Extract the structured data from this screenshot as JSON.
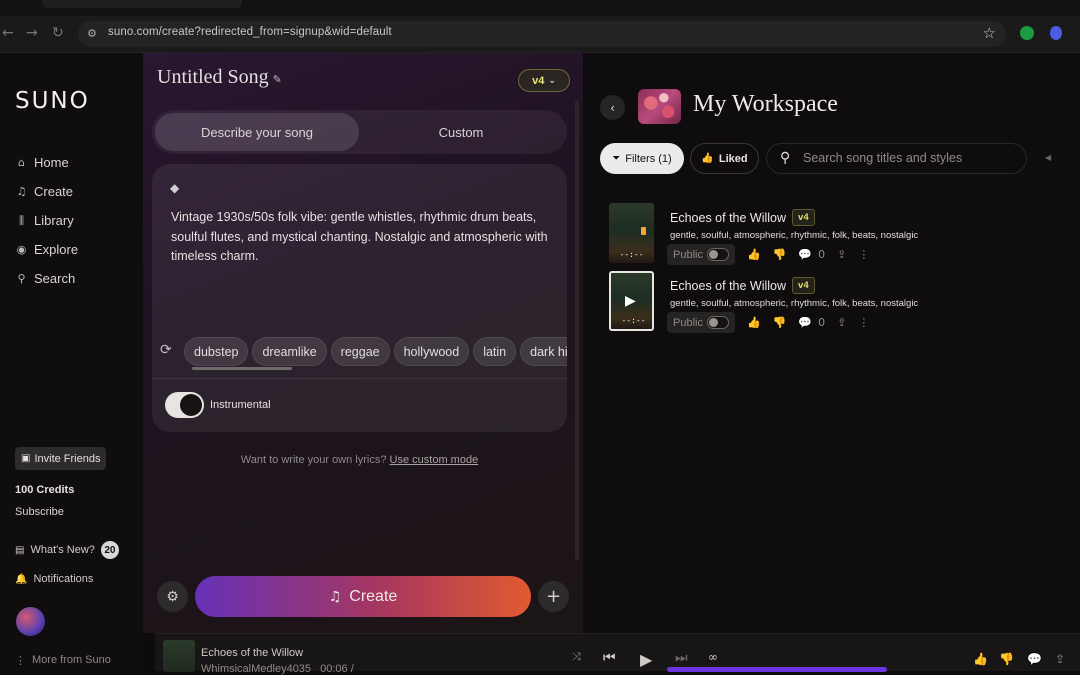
{
  "browser": {
    "url": "suno.com/create?redirected_from=signup&wid=default"
  },
  "sidebar": {
    "logo": "SUNO",
    "items": [
      {
        "label": "Home",
        "icon": "home-icon"
      },
      {
        "label": "Create",
        "icon": "music-note-icon"
      },
      {
        "label": "Library",
        "icon": "library-icon"
      },
      {
        "label": "Explore",
        "icon": "compass-icon"
      },
      {
        "label": "Search",
        "icon": "search-icon"
      }
    ],
    "invite_label": "Invite Friends",
    "credits": "100 Credits",
    "subscribe": "Subscribe",
    "whats_new": "What's New?",
    "whats_new_count": "20",
    "notifications": "Notifications",
    "more": "More from Suno"
  },
  "create": {
    "song_title": "Untitled Song",
    "version": "v4",
    "tabs": [
      "Describe your song",
      "Custom"
    ],
    "prompt": "Vintage 1930s/50s folk vibe: gentle whistles, rhythmic drum beats, soulful flutes, and mystical chanting. Nostalgic and atmospheric with timeless charm.",
    "chips": [
      "dubstep",
      "dreamlike",
      "reggae",
      "hollywood",
      "latin",
      "dark hiphop"
    ],
    "instrumental_label": "Instrumental",
    "instrumental_on": true,
    "lyrics_hint": "Want to write your own lyrics?",
    "lyrics_link": "Use custom mode",
    "create_label": "Create"
  },
  "workspace": {
    "title": "My Workspace",
    "filters_label": "Filters (1)",
    "liked_label": "Liked",
    "search_placeholder": "Search song titles and styles",
    "songs": [
      {
        "title": "Echoes of the Willow",
        "version": "v4",
        "tags": "gentle, soulful, atmospheric, rhythmic, folk, beats, nostalgic",
        "public_label": "Public",
        "comments": "0",
        "duration": "--:--"
      },
      {
        "title": "Echoes of the Willow",
        "version": "v4",
        "tags": "gentle, soulful, atmospheric, rhythmic, folk, beats, nostalgic",
        "public_label": "Public",
        "comments": "0",
        "duration": "--:--"
      }
    ]
  },
  "player": {
    "title": "Echoes of the Willow",
    "artist": "WhimsicalMedley4035",
    "time": "00:06 /",
    "progress": 0.04
  }
}
